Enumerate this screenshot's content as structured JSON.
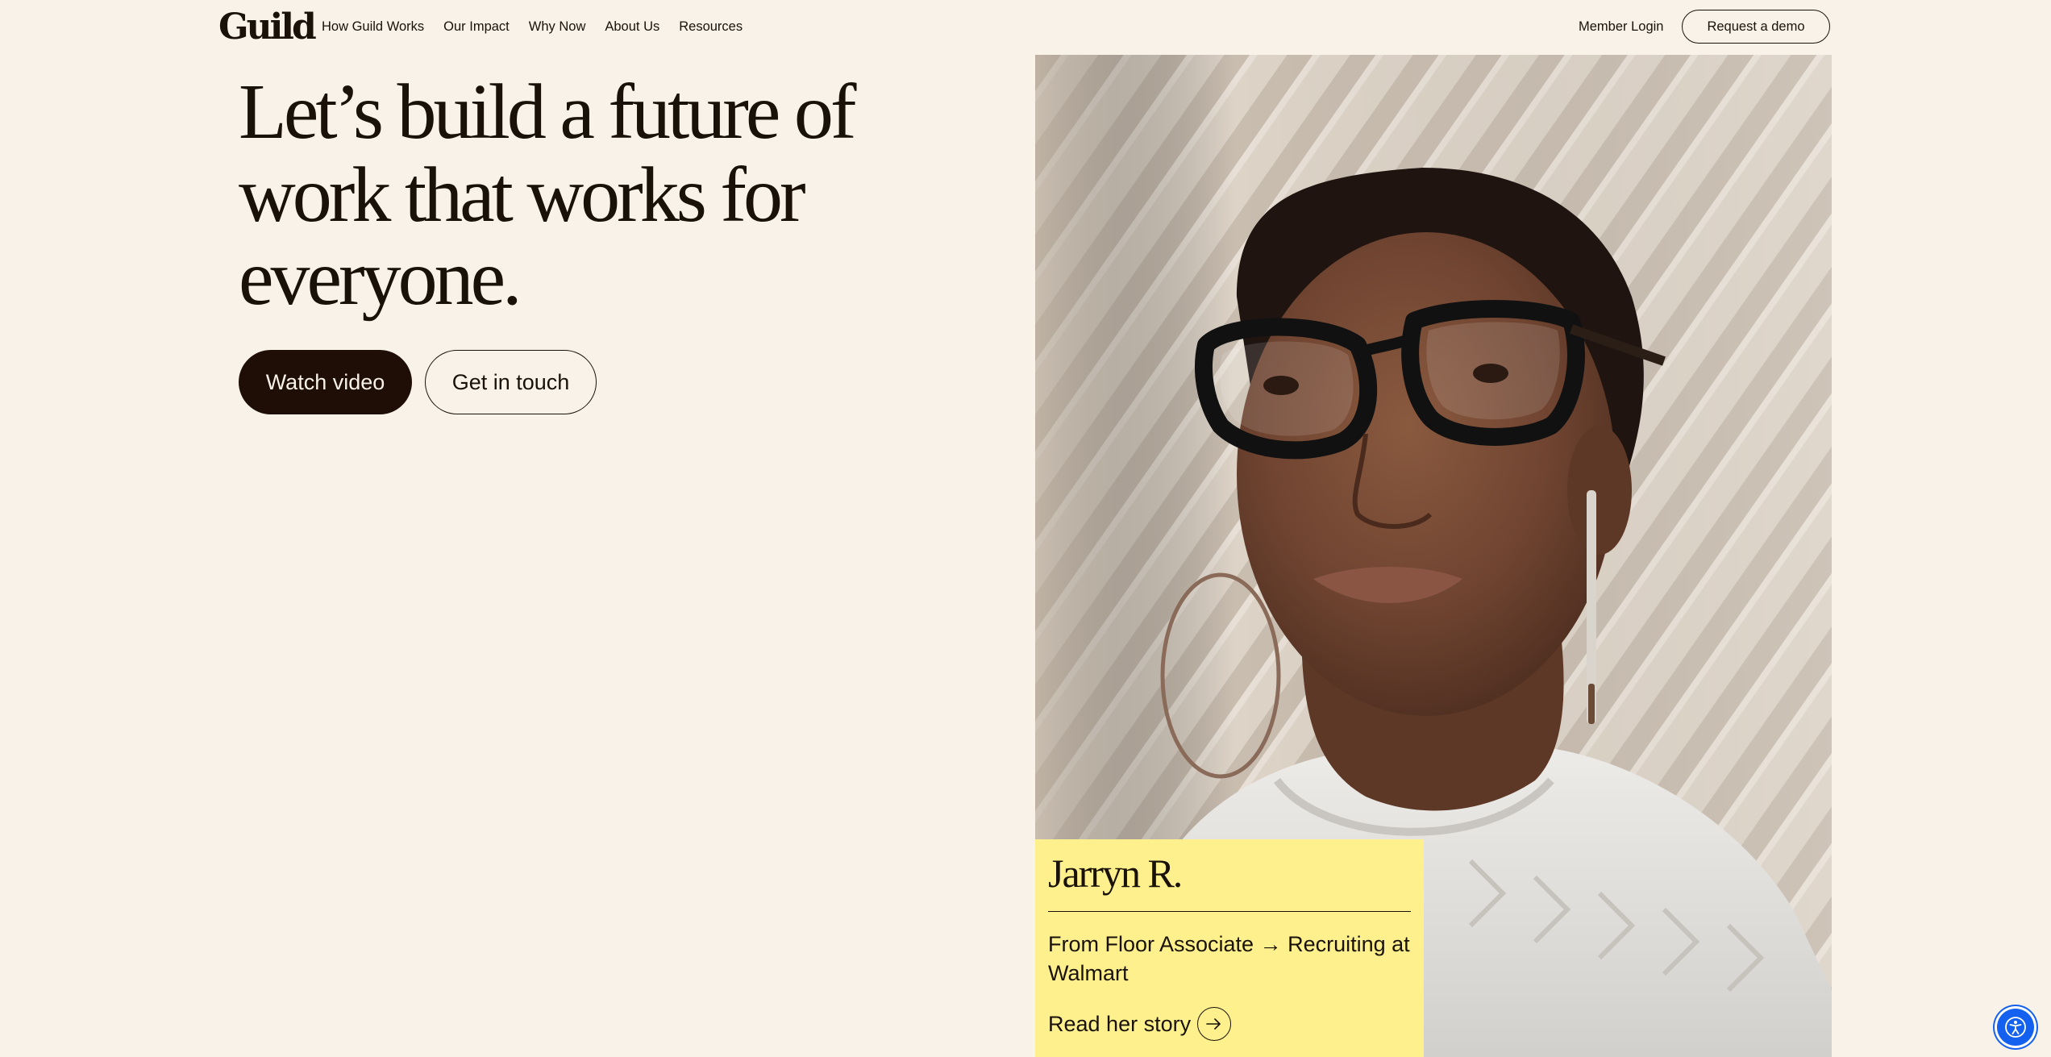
{
  "header": {
    "logo_text": "Guild",
    "nav_items": [
      {
        "label": "How Guild Works"
      },
      {
        "label": "Our Impact"
      },
      {
        "label": "Why Now"
      },
      {
        "label": "About Us"
      },
      {
        "label": "Resources"
      }
    ],
    "member_login": "Member Login",
    "request_demo": "Request a demo"
  },
  "hero": {
    "heading": "Let’s build a future of work that works for everyone.",
    "watch_video": "Watch video",
    "get_in_touch": "Get in touch"
  },
  "story": {
    "name": "Jarryn R.",
    "role": "From Floor Associate → Recruiting at Walmart",
    "cta": "Read her story",
    "cta_icon": "arrow-right-icon"
  },
  "accessibility": {
    "icon": "accessibility-icon"
  },
  "colors": {
    "background": "#f8f2e9",
    "text": "#1a1208",
    "primary_button": "#1e0e05",
    "story_card": "#fdf08d",
    "accessibility_button": "#1461f0"
  }
}
